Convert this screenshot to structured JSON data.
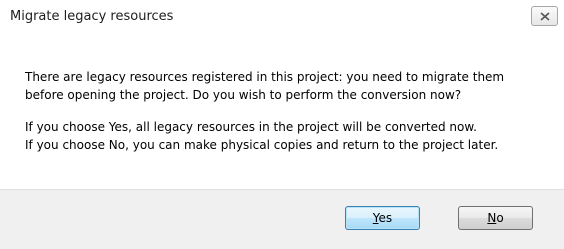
{
  "window": {
    "title": "Migrate legacy resources",
    "close_icon": "close-icon"
  },
  "message": {
    "line1": "There are legacy resources registered in this project: you need to migrate them",
    "line2": "before opening the project. Do you wish to perform the conversion now?",
    "line3": "If you choose Yes, all legacy resources in the project will be converted now.",
    "line4": "If you choose No, you can make physical copies and return to the project later."
  },
  "buttons": {
    "yes_access": "Y",
    "yes_rest": "es",
    "no_access": "N",
    "no_rest": "o"
  },
  "colors": {
    "footer_bg": "#f0f0f0",
    "default_button_border": "#3c7fb1"
  }
}
